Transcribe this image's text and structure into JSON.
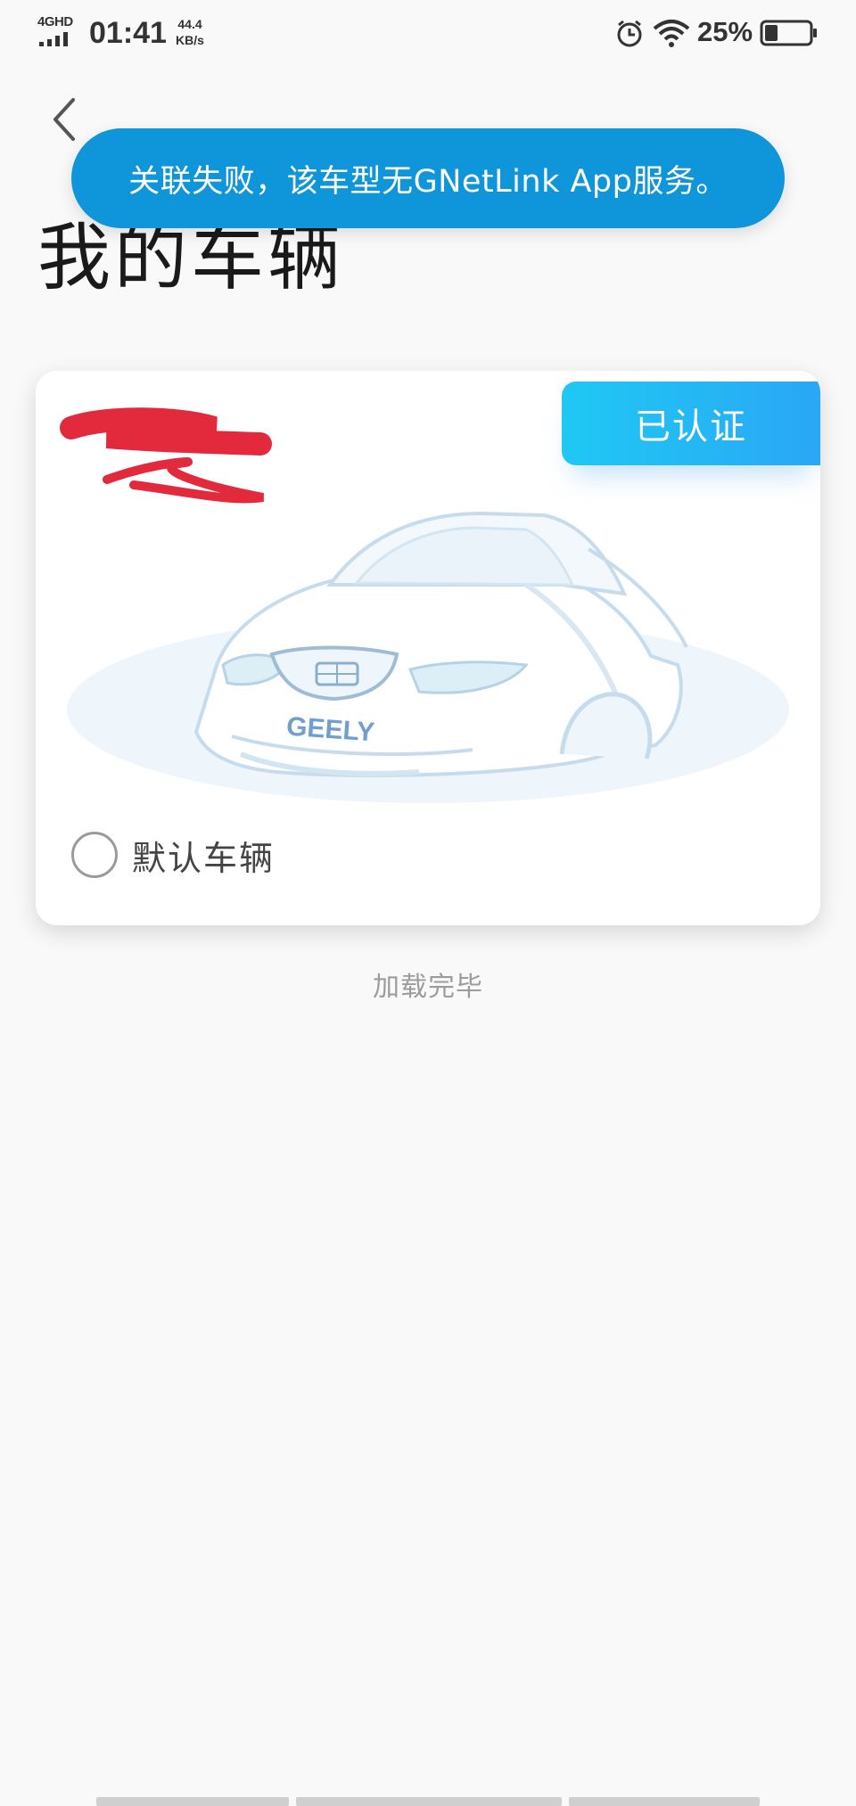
{
  "status_bar": {
    "network": "4GHD",
    "time": "01:41",
    "speed_value": "44.4",
    "speed_unit": "KB/s",
    "battery": "25%"
  },
  "toast": {
    "message": "关联失败，该车型无GNetLink App服务。"
  },
  "page": {
    "title": "我的车辆"
  },
  "vehicle_card": {
    "badge": "已认证",
    "brand_logo_text": "GEELY",
    "default_label": "默认车辆",
    "is_default": false,
    "plate_redacted": true
  },
  "list_footer": {
    "status": "加载完毕"
  },
  "colors": {
    "toast_bg": "#0f95d9",
    "badge_start": "#1fc8f4",
    "badge_end": "#2aa7f5",
    "redaction": "#e3293c"
  },
  "icons": {
    "back": "chevron-left-icon",
    "alarm": "alarm-icon",
    "wifi": "wifi-icon",
    "battery": "battery-icon",
    "signal": "signal-icon"
  }
}
